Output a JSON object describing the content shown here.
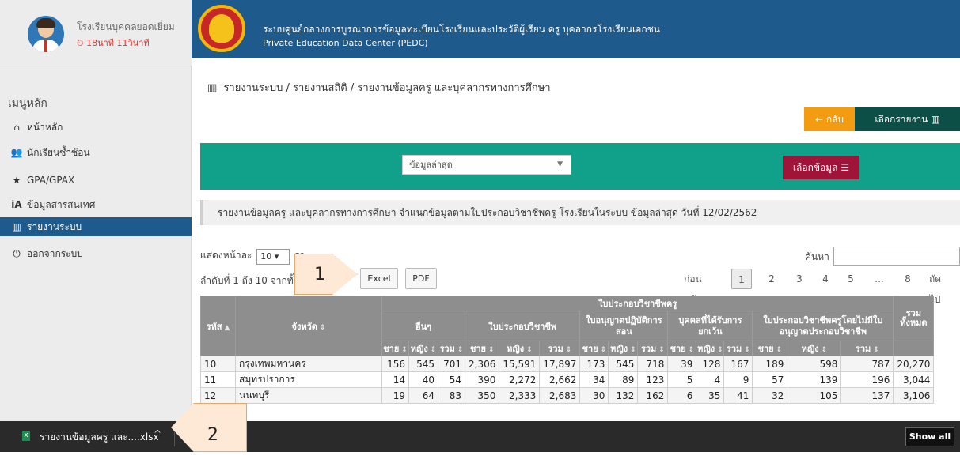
{
  "sidebar": {
    "user": {
      "name": "โรงเรียนบุคคลยอดเยี่ยม",
      "meta": "18นาที 11วินาที"
    },
    "menu_title": "เมนูหลัก",
    "items": [
      {
        "label": "หน้าหลัก",
        "icon": "home-icon"
      },
      {
        "label": "นักเรียนซ้ำซ้อน",
        "icon": "users-icon"
      },
      {
        "label": "GPA/GPAX",
        "icon": "star-icon"
      },
      {
        "label": "ข้อมูลสารสนเทศ",
        "icon": "info-icon"
      },
      {
        "label": "รายงานระบบ",
        "icon": "bar-chart-icon",
        "active": true
      },
      {
        "label": "ออกจากระบบ",
        "icon": "power-icon"
      }
    ]
  },
  "header": {
    "title_th": "ระบบศูนย์กลางการบูรณาการข้อมูลทะเบียนโรงเรียนและประวัติผู้เรียน ครู บุคลากรโรงเรียนเอกชน",
    "title_en": "Private Education Data Center (PEDC)"
  },
  "breadcrumb": {
    "link1": "รายงานระบบ",
    "sep": "/",
    "link2": "รายงานสถิติ",
    "current": "รายงานข้อมูลครู และบุคลากรทางการศึกษา"
  },
  "buttons": {
    "back": "กลับ",
    "choose_report": "เลือกรายงาน",
    "choose_data": "เลือกข้อมูล"
  },
  "filter": {
    "selected": "ข้อมูลล่าสุด"
  },
  "description": "รายงานข้อมูลครู และบุคลากรทางการศึกษา จำแนกข้อมูลตามใบประกอบวิชาชีพครู โรงเรียนในระบบ ข้อมูลล่าสุด วันที่ 12/02/2562",
  "controls": {
    "length_prefix": "แสดงหน้าละ",
    "length_value": "10",
    "length_suffix": "รา",
    "search_label": "ค้นหา",
    "info": "ลำดับที่ 1 ถึง 10 จากทั้งห",
    "excel": "Excel",
    "pdf": "PDF"
  },
  "pagination": {
    "prev": "ก่อนหน้า",
    "pages": [
      "1",
      "2",
      "3",
      "4",
      "5"
    ],
    "ellipsis": "...",
    "last": "8",
    "next": "ถัดไป"
  },
  "callouts": {
    "one": "1",
    "two": "2"
  },
  "table": {
    "group_header": "ใบประกอบวิชาชีพครู",
    "col_code": "รหัส",
    "col_province": "จังหวัด",
    "groups": [
      "อื่นๆ",
      "ใบประกอบวิชาชีพ",
      "ใบอนุญาตปฏิบัติการสอน",
      "บุคคลที่ได้รับการยกเว้น",
      "ใบประกอบวิชาชีพครูโดยไม่มีใบอนุญาตประกอบวิชาชีพ"
    ],
    "col_total": "รวมทั้งหมด",
    "sub_male": "ชาย",
    "sub_female": "หญิง",
    "sub_total": "รวม",
    "rows": [
      {
        "code": "10",
        "province": "กรุงเทพมหานคร",
        "vals": [
          "156",
          "545",
          "701",
          "2,306",
          "15,591",
          "17,897",
          "173",
          "545",
          "718",
          "39",
          "128",
          "167",
          "189",
          "598",
          "787",
          "20,270"
        ]
      },
      {
        "code": "11",
        "province": "สมุทรปราการ",
        "vals": [
          "14",
          "40",
          "54",
          "390",
          "2,272",
          "2,662",
          "34",
          "89",
          "123",
          "5",
          "4",
          "9",
          "57",
          "139",
          "196",
          "3,044"
        ]
      },
      {
        "code": "12",
        "province": "นนทบุรี",
        "vals": [
          "19",
          "64",
          "83",
          "350",
          "2,333",
          "2,683",
          "30",
          "132",
          "162",
          "6",
          "35",
          "41",
          "32",
          "105",
          "137",
          "3,106"
        ]
      }
    ]
  },
  "download_bar": {
    "file_name": "รายงานข้อมูลครู และ....xlsx",
    "show_all": "Show all"
  }
}
